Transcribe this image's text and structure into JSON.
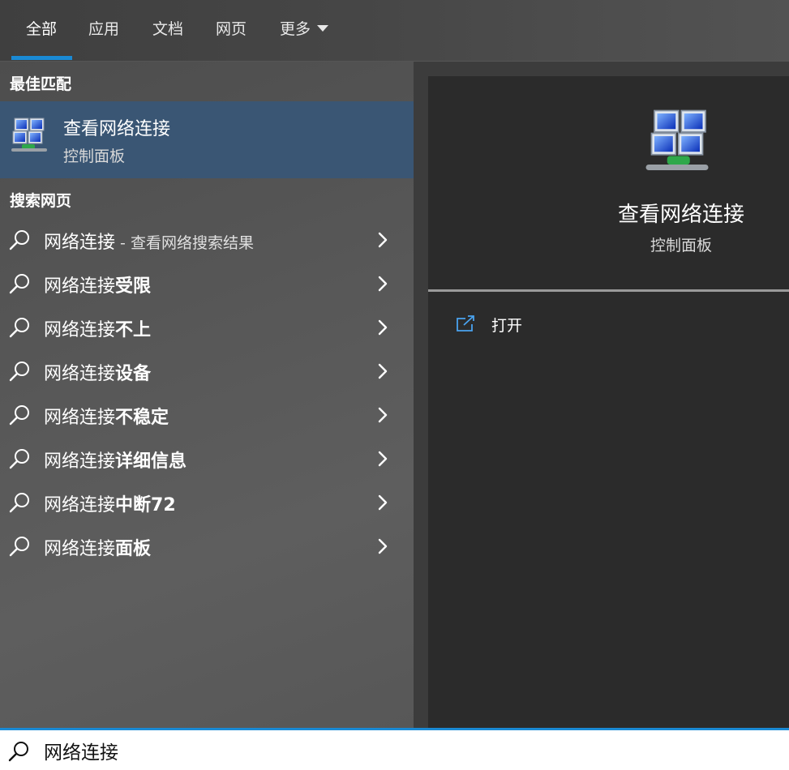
{
  "tabs": [
    {
      "label": "全部",
      "active": true
    },
    {
      "label": "应用",
      "active": false
    },
    {
      "label": "文档",
      "active": false
    },
    {
      "label": "网页",
      "active": false
    },
    {
      "label": "更多",
      "active": false
    }
  ],
  "best_match": {
    "section_label": "最佳匹配",
    "title": "查看网络连接",
    "subtitle": "控制面板",
    "icon": "network-connections-icon"
  },
  "web_search": {
    "section_label": "搜索网页",
    "first": {
      "plain": "网络连接",
      "suffix": " - 查看网络搜索结果"
    },
    "items": [
      {
        "plain": "网络连接",
        "bold": "受限"
      },
      {
        "plain": "网络连接",
        "bold": "不上"
      },
      {
        "plain": "网络连接",
        "bold": "设备"
      },
      {
        "plain": "网络连接",
        "bold": "不稳定"
      },
      {
        "plain": "网络连接",
        "bold": "详细信息"
      },
      {
        "plain": "网络连接",
        "bold": "中断72"
      },
      {
        "plain": "网络连接",
        "bold": "面板"
      }
    ]
  },
  "preview": {
    "title": "查看网络连接",
    "subtitle": "控制面板",
    "actions": [
      {
        "label": "打开",
        "icon": "open-external-icon"
      }
    ]
  },
  "search_box": {
    "value": "网络连接"
  },
  "colors": {
    "accent": "#1a8ad4",
    "selected_row": "#3a5674",
    "preview_bg": "#2b2b2b"
  }
}
